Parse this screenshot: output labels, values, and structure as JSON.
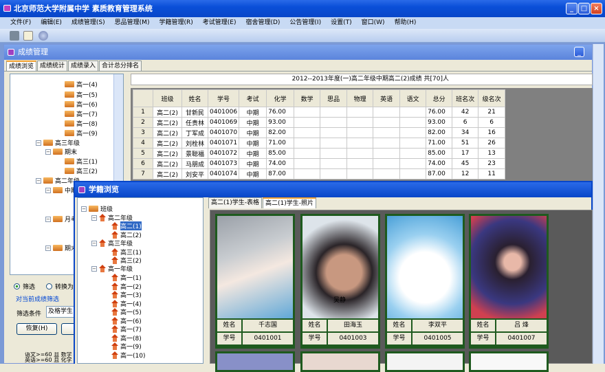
{
  "app": {
    "title": "北京师范大学附属中学  素质教育管理系统"
  },
  "menu": [
    "文件(F)",
    "编辑(E)",
    "成绩管理(S)",
    "思品管理(M)",
    "学籍管理(R)",
    "考试管理(E)",
    "宿舍管理(D)",
    "公告管理(I)",
    "设置(T)",
    "窗口(W)",
    "帮助(H)"
  ],
  "grades_window": {
    "title": "成绩管理",
    "tabs": [
      "成绩浏览",
      "成绩统计",
      "成绩录入",
      "合计总分排名"
    ],
    "tree": [
      "高一(4)",
      "高一(5)",
      "高一(6)",
      "高一(7)",
      "高一(8)",
      "高一(9)",
      "高三年级",
      "期末",
      "高三(1)",
      "高三(2)",
      "高二年级",
      "中期",
      "月考",
      "期末"
    ],
    "filter": {
      "radio_filter": "筛选",
      "radio_convert": "转换为",
      "group": "对当前成绩筛选",
      "cond_label": "筛选条件",
      "cond_value": "及格学生",
      "restore": "恢复(H)",
      "cond_text1": "语文>=60 且 数学",
      "cond_text2": "英语>=60 且 化学"
    },
    "caption": "2012--2013年度(一)高二年级中期高二(2)成绩   共[70]人",
    "columns": [
      "",
      "班级",
      "姓名",
      "学号",
      "考试",
      "化学",
      "数学",
      "思品",
      "物理",
      "英语",
      "语文",
      "总分",
      "班名次",
      "级名次"
    ],
    "rows": [
      [
        "1",
        "高二(2)",
        "甘新民",
        "0401006",
        "中期",
        "76.00",
        "",
        "",
        "",
        "",
        "",
        "76.00",
        "42",
        "21"
      ],
      [
        "2",
        "高二(2)",
        "任贵林",
        "0401069",
        "中期",
        "93.00",
        "",
        "",
        "",
        "",
        "",
        "93.00",
        "6",
        "6"
      ],
      [
        "3",
        "高二(2)",
        "丁军成",
        "0401070",
        "中期",
        "82.00",
        "",
        "",
        "",
        "",
        "",
        "82.00",
        "34",
        "16"
      ],
      [
        "4",
        "高二(2)",
        "刘栓林",
        "0401071",
        "中期",
        "71.00",
        "",
        "",
        "",
        "",
        "",
        "71.00",
        "51",
        "26"
      ],
      [
        "5",
        "高二(2)",
        "景聪福",
        "0401072",
        "中期",
        "85.00",
        "",
        "",
        "",
        "",
        "",
        "85.00",
        "17",
        "13"
      ],
      [
        "6",
        "高二(2)",
        "马朋成",
        "0401073",
        "中期",
        "74.00",
        "",
        "",
        "",
        "",
        "",
        "74.00",
        "45",
        "23"
      ],
      [
        "7",
        "高二(2)",
        "刘安平",
        "0401074",
        "中期",
        "87.00",
        "",
        "",
        "",
        "",
        "",
        "87.00",
        "12",
        "11"
      ]
    ]
  },
  "student_window": {
    "title": "学籍浏览",
    "tree": {
      "root": "班级",
      "g2": "高二年级",
      "g2c": [
        "高二(1)",
        "高二(2)"
      ],
      "g3": "高三年级",
      "g3c": [
        "高三(1)",
        "高三(2)"
      ],
      "g1": "高一年级",
      "g1c": [
        "高一(1)",
        "高一(2)",
        "高一(3)",
        "高一(4)",
        "高一(5)",
        "高一(6)",
        "高一(7)",
        "高一(8)",
        "高一(9)",
        "高一(10)"
      ]
    },
    "tabs": [
      "高二(1)学生-表格",
      "高二(1)学生-照片"
    ],
    "name_label": "姓名",
    "id_label": "学号",
    "cards": [
      {
        "name": "千志国",
        "id": "0401001"
      },
      {
        "name": "田海玉",
        "id": "0401003",
        "caption": "吴静"
      },
      {
        "name": "李双平",
        "id": "0401005"
      },
      {
        "name": "吕  烽",
        "id": "0401007"
      }
    ]
  }
}
